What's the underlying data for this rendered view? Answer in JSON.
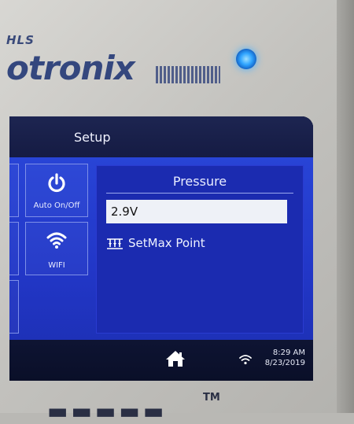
{
  "device": {
    "brand_small": "HLS",
    "brand_main": "otronix"
  },
  "title": "Setup",
  "tiles": [
    {
      "label": "Auto On/Off",
      "icon": "power-icon"
    },
    {
      "label": "WIFI",
      "icon": "wifi-icon"
    }
  ],
  "panel": {
    "title": "Pressure",
    "value": "2.9V",
    "action_label": "SetMax Point",
    "action_icon": "adjust-icon"
  },
  "status": {
    "time": "8:29 AM",
    "date": "8/23/2019",
    "home_icon": "home-icon",
    "wifi_icon": "wifi-icon"
  },
  "colors": {
    "screen_blue": "#2237c8",
    "panel_blue": "#1b2bb0",
    "led": "#2fa4ff"
  }
}
